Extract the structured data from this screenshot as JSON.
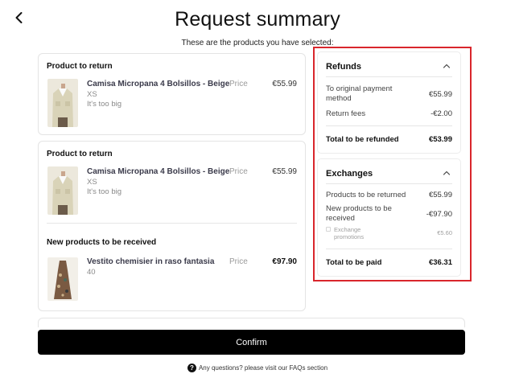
{
  "header": {
    "title": "Request summary",
    "subtitle": "These are the products you have selected:"
  },
  "returns": [
    {
      "section_title": "Product to return",
      "product": {
        "name": "Camisa Micropana 4 Bolsillos - Beige",
        "size": "XS",
        "reason": "It's too big",
        "price_label": "Price",
        "price": "€55.99"
      }
    },
    {
      "section_title": "Product to return",
      "product": {
        "name": "Camisa Micropana 4 Bolsillos - Beige",
        "size": "XS",
        "reason": "It's too big",
        "price_label": "Price",
        "price": "€55.99"
      },
      "new_section_title": "New products to be received",
      "new_product": {
        "name": "Vestito chemisier in raso fantasia",
        "size": "40",
        "price_label": "Price",
        "price": "€97.90"
      }
    }
  ],
  "refunds": {
    "title": "Refunds",
    "rows": [
      {
        "label": "To original payment method",
        "value": "€55.99"
      },
      {
        "label": "Return fees",
        "value": "-€2.00"
      }
    ],
    "total_label": "Total to be refunded",
    "total_value": "€53.99"
  },
  "exchanges": {
    "title": "Exchanges",
    "rows": [
      {
        "label": "Products to be returned",
        "value": "€55.99"
      },
      {
        "label": "New products to be received",
        "value": "-€97.90"
      }
    ],
    "promo_label": "Exchange promotions",
    "promo_value": "€5.60",
    "total_label": "Total to be paid",
    "total_value": "€36.31"
  },
  "actions": {
    "confirm_label": "Confirm",
    "faq_text": "Any questions? please visit our FAQs section",
    "help_glyph": "?"
  },
  "colors": {
    "highlight_border": "#d9262c",
    "button_bg": "#000000",
    "shirt_beige": "#d9d3b8",
    "dress_print": "#7a5a42"
  },
  "icons": {
    "back": "chevron-left-icon",
    "collapse": "chevron-up-icon",
    "help": "question-circle-icon"
  }
}
